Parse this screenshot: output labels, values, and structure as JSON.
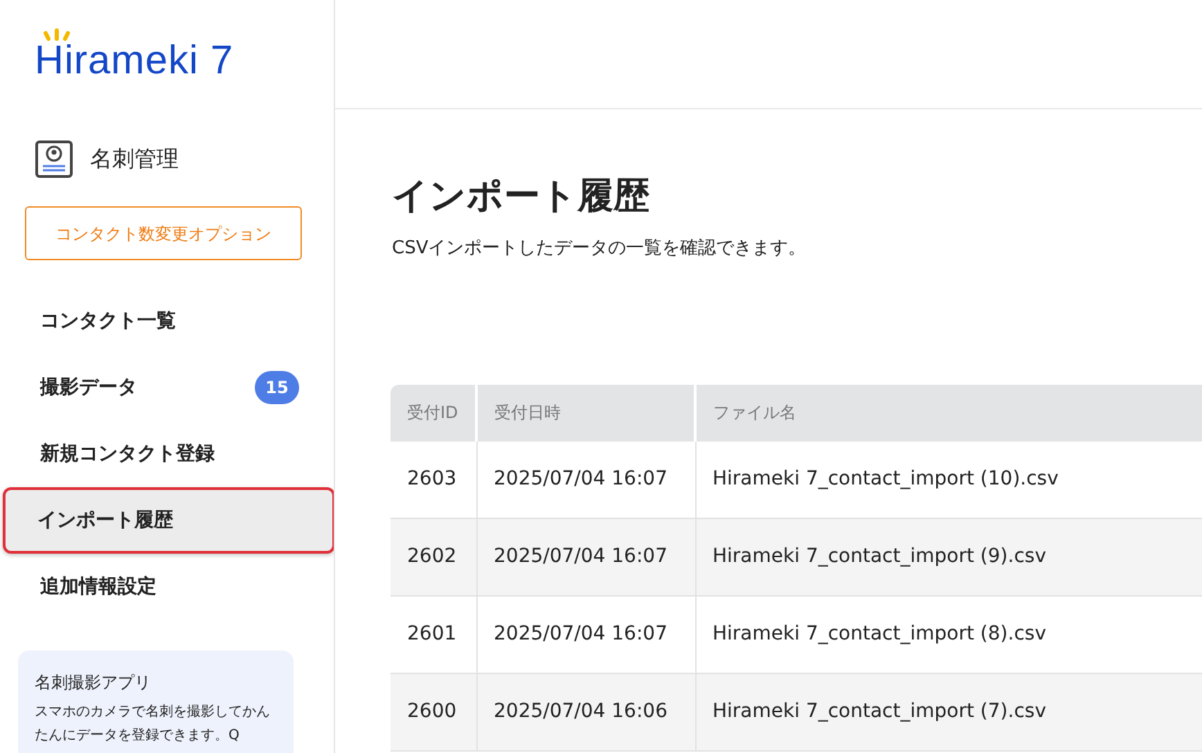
{
  "sidebar": {
    "logo": "Hirameki 7",
    "section_title": "名刺管理",
    "option_button": "コンタクト数変更オプション",
    "items": [
      {
        "label": "コンタクト一覧",
        "selected": false
      },
      {
        "label": "撮影データ",
        "selected": false,
        "badge": "15"
      },
      {
        "label": "新規コンタクト登録",
        "selected": false
      },
      {
        "label": "インポート履歴",
        "selected": true
      },
      {
        "label": "追加情報設定",
        "selected": false
      }
    ],
    "app_card": {
      "title": "名刺撮影アプリ",
      "text": "スマホのカメラで名刺を撮影してかんたんにデータを登録できます。Q"
    }
  },
  "page": {
    "title": "インポート履歴",
    "subtitle": "CSVインポートしたデータの一覧を確認できます。"
  },
  "table": {
    "columns": [
      "受付ID",
      "受付日時",
      "ファイル名"
    ],
    "rows": [
      [
        "2603",
        "2025/07/04 16:07",
        "Hirameki 7_contact_import (10).csv"
      ],
      [
        "2602",
        "2025/07/04 16:07",
        "Hirameki 7_contact_import (9).csv"
      ],
      [
        "2601",
        "2025/07/04 16:07",
        "Hirameki 7_contact_import (8).csv"
      ],
      [
        "2600",
        "2025/07/04 16:06",
        "Hirameki 7_contact_import (7).csv"
      ]
    ]
  }
}
